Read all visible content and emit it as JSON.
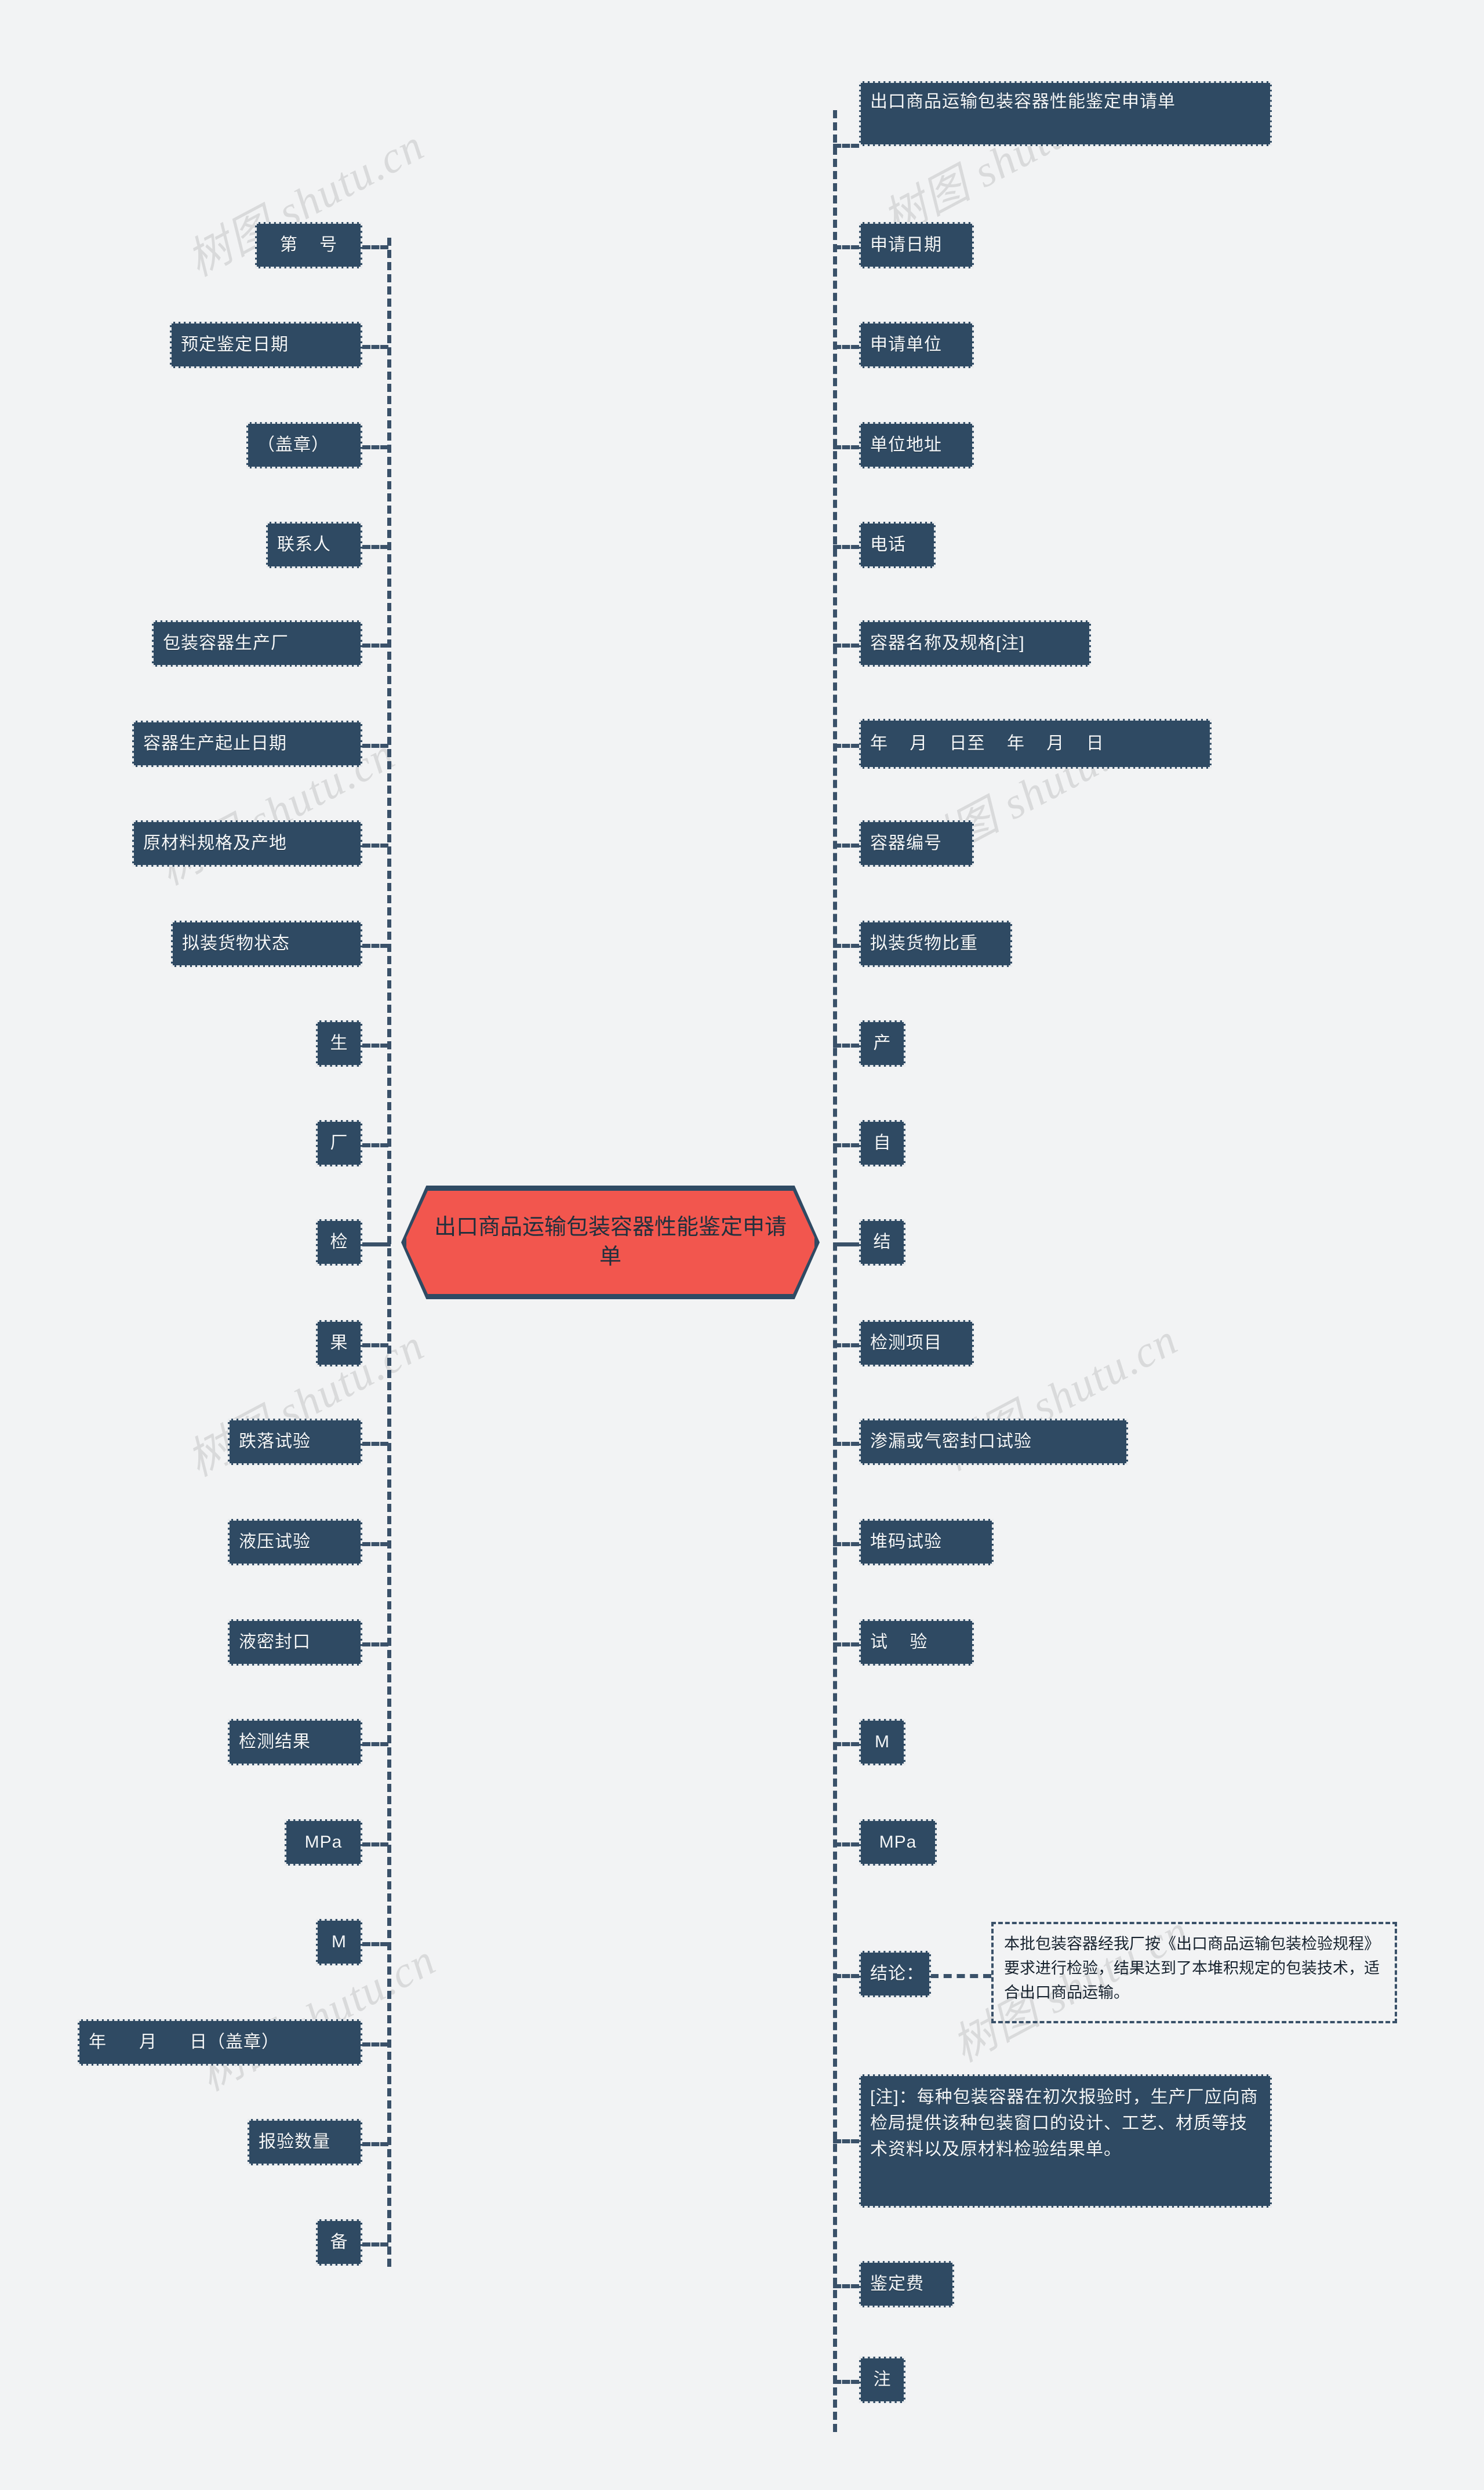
{
  "meta": {
    "title": "出口商品运输包装容器性能鉴定申请单",
    "colors": {
      "background": "#f2f3f4",
      "node_fill": "#2f4a63",
      "node_text": "#f4f7f9",
      "root_fill": "#f2564e",
      "root_stroke": "#2f4a63",
      "connector": "#3a5169"
    }
  },
  "watermark": {
    "text": "树图 shutu.cn"
  },
  "root": {
    "label": "出口商品运输包装容器性能鉴定申请单"
  },
  "right_branch": [
    {
      "label": "出口商品运输包装容器性能鉴定申请单"
    },
    {
      "label": "申请日期"
    },
    {
      "label": "申请单位"
    },
    {
      "label": "单位地址"
    },
    {
      "label": "电话"
    },
    {
      "label": "容器名称及规格[注]"
    },
    {
      "label": "年    月    日至    年    月    日"
    },
    {
      "label": "容器编号"
    },
    {
      "label": "拟装货物比重"
    },
    {
      "label": "产"
    },
    {
      "label": "自"
    },
    {
      "label": "结"
    },
    {
      "label": "检测项目"
    },
    {
      "label": "渗漏或气密封口试验"
    },
    {
      "label": "堆码试验"
    },
    {
      "label": "试    验"
    },
    {
      "label": "M"
    },
    {
      "label": "MPa"
    },
    {
      "label": "结论："
    },
    {
      "label": "[注]：每种包装容器在初次报验时，生产厂应向商检局提供该种包装窗口的设计、工艺、材质等技术资料以及原材料检验结果单。"
    },
    {
      "label": "鉴定费"
    },
    {
      "label": "注"
    }
  ],
  "left_branch": [
    {
      "label": "第    号"
    },
    {
      "label": "预定鉴定日期"
    },
    {
      "label": "（盖章）"
    },
    {
      "label": "联系人"
    },
    {
      "label": "包装容器生产厂"
    },
    {
      "label": "容器生产起止日期"
    },
    {
      "label": "原材料规格及产地"
    },
    {
      "label": "拟装货物状态"
    },
    {
      "label": "生"
    },
    {
      "label": "厂"
    },
    {
      "label": "检"
    },
    {
      "label": "果"
    },
    {
      "label": "跌落试验"
    },
    {
      "label": "液压试验"
    },
    {
      "label": "液密封口"
    },
    {
      "label": "检测结果"
    },
    {
      "label": "MPa"
    },
    {
      "label": "M"
    },
    {
      "label": "年      月      日（盖章）"
    },
    {
      "label": "报验数量"
    },
    {
      "label": "备"
    }
  ],
  "conclusion_note": {
    "text": "本批包装容器经我厂按《出口商品运输包装检验规程》要求进行检验，结果达到了本堆积规定的包装技术，适合出口商品运输。"
  }
}
